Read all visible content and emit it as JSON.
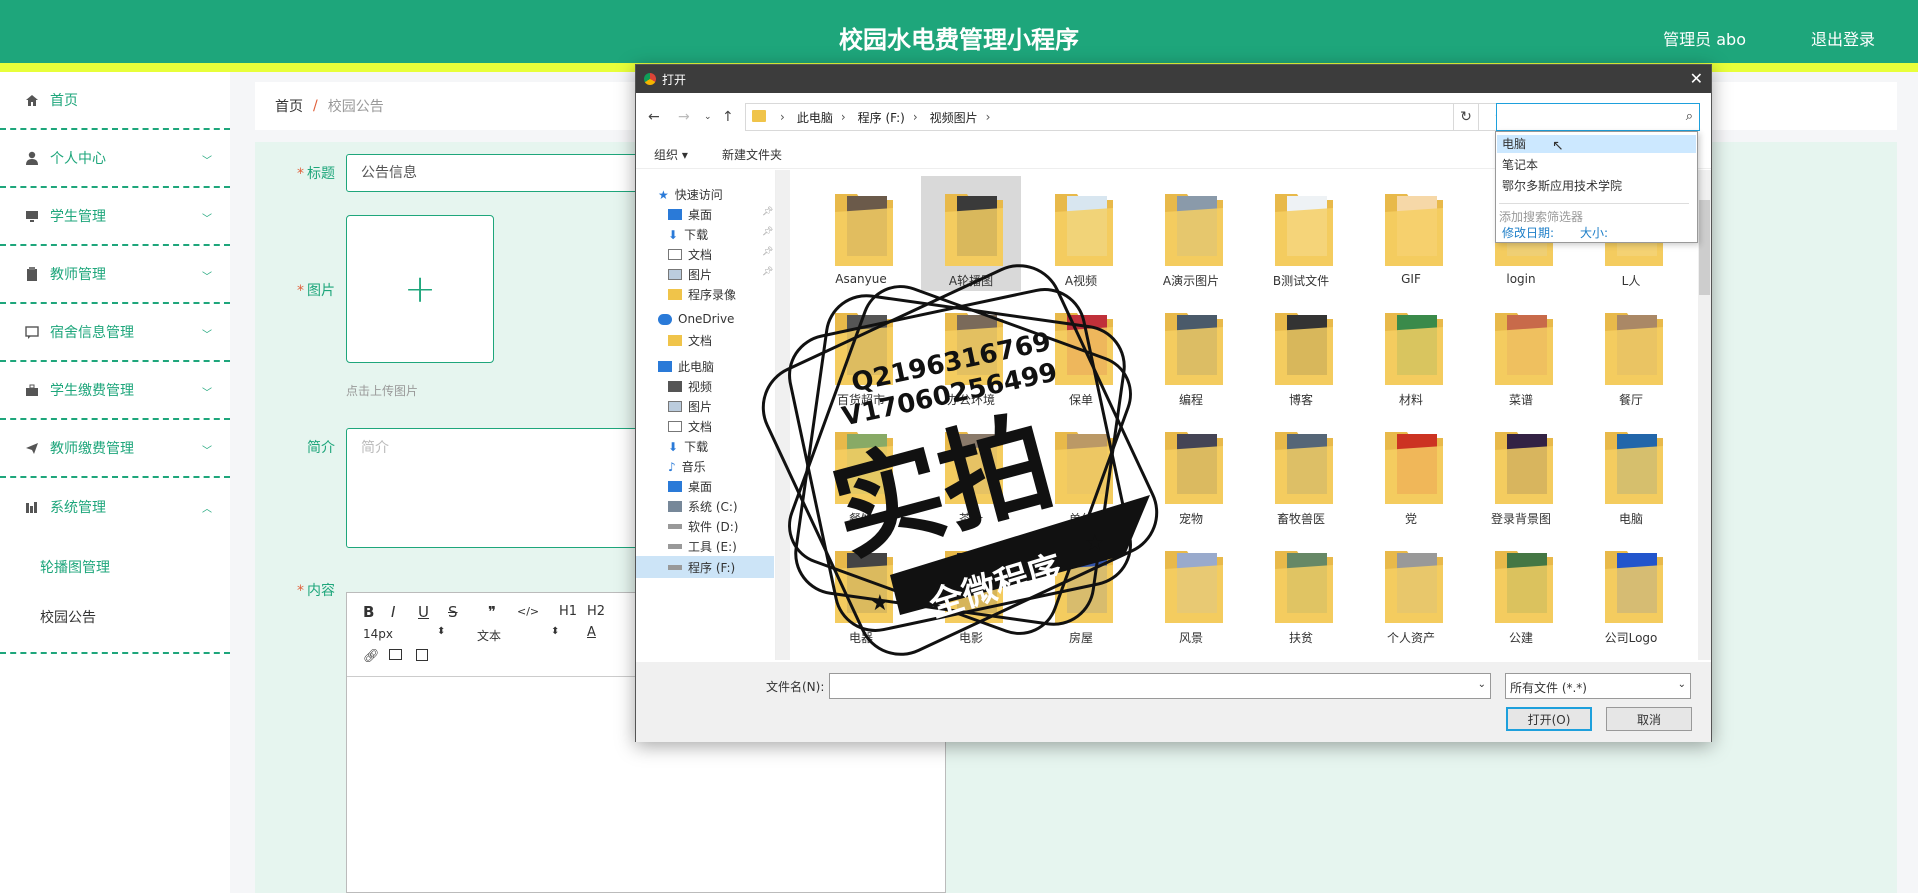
{
  "header": {
    "title": "校园水电费管理小程序",
    "user": "管理员 abo",
    "logout": "退出登录"
  },
  "sidebar": {
    "items": [
      {
        "label": "首页",
        "icon": "home-icon"
      },
      {
        "label": "个人中心",
        "icon": "user-icon"
      },
      {
        "label": "学生管理",
        "icon": "monitor-icon"
      },
      {
        "label": "教师管理",
        "icon": "clipboard-icon"
      },
      {
        "label": "宿舍信息管理",
        "icon": "chat-icon"
      },
      {
        "label": "学生缴费管理",
        "icon": "briefcase-icon"
      },
      {
        "label": "教师缴费管理",
        "icon": "send-icon"
      },
      {
        "label": "系统管理",
        "icon": "chart-icon"
      }
    ],
    "sub_items": [
      {
        "label": "轮播图管理"
      },
      {
        "label": "校园公告"
      }
    ]
  },
  "breadcrumb": {
    "home": "首页",
    "sep": "/",
    "current": "校园公告"
  },
  "form": {
    "title_label": "标题",
    "title_value": "公告信息",
    "image_label": "图片",
    "upload_plus": "+",
    "upload_hint": "点击上传图片",
    "intro_label": "简介",
    "intro_placeholder": "简介",
    "content_label": "内容",
    "editor": {
      "bold": "B",
      "italic": "I",
      "underline": "U",
      "strike": "S",
      "quote": "❞",
      "code": "</>",
      "h1": "H1",
      "h2": "H2",
      "fontsize": "14px",
      "font": "文本"
    }
  },
  "dialog": {
    "title": "打开",
    "path": [
      "此电脑",
      "程序 (F:)",
      "视频图片"
    ],
    "organize": "组织 ▾",
    "new_folder": "新建文件夹",
    "nav": [
      "快速访问",
      "桌面",
      "下载",
      "文档",
      "图片",
      "程序录像",
      "OneDrive",
      "文档",
      "此电脑",
      "视频",
      "图片",
      "文档",
      "下载",
      "音乐",
      "桌面",
      "系统 (C:)",
      "软件 (D:)",
      "工具 (E:)",
      "程序 (F:)"
    ],
    "files": [
      "Asanyue",
      "A轮播图",
      "A视频",
      "A演示图片",
      "B测试文件",
      "GIF",
      "login",
      "L人",
      "百货超市",
      "办公环境",
      "保单",
      "编程",
      "博客",
      "材料",
      "菜谱",
      "餐厅",
      "餐饮",
      "茶叶",
      "单位",
      "宠物",
      "畜牧兽医",
      "党",
      "登录背景图",
      "电脑",
      "电器",
      "电影",
      "房屋",
      "风景",
      "扶贫",
      "个人资产",
      "公建",
      "公司Logo"
    ],
    "filename_label": "文件名(N):",
    "filetype": "所有文件 (*.*)",
    "open_btn": "打开(O)",
    "cancel_btn": "取消",
    "search_dropdown": [
      "电脑",
      "笔记本",
      "鄂尔多斯应用技术学院"
    ],
    "filter_add": "添加搜索筛选器",
    "filter_date": "修改日期:",
    "filter_size": "大小:"
  },
  "watermark": {
    "line1": "Q2196316769",
    "line2": "V17060256499",
    "main": "实拍",
    "sub": "全微程序"
  }
}
